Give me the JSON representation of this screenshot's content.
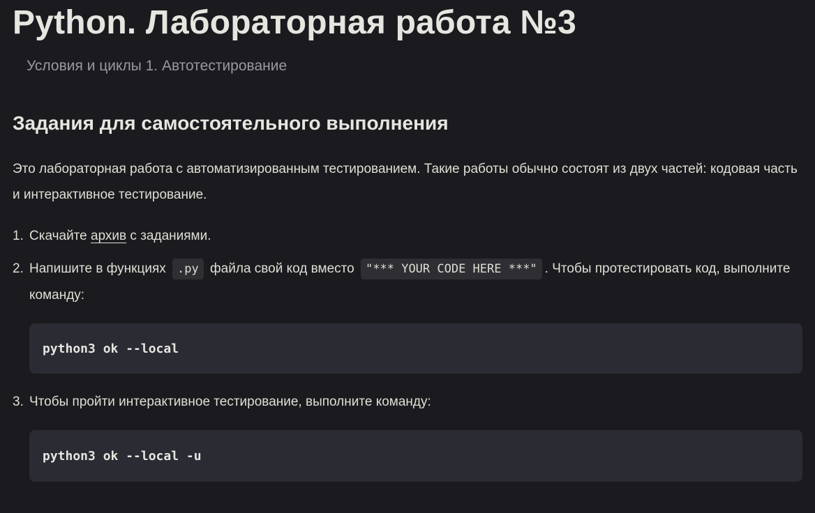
{
  "page": {
    "title": "Python. Лабораторная работа №3",
    "subtitle": "Условия и циклы 1. Автотестирование"
  },
  "section": {
    "heading": "Задания для самостоятельного выполнения",
    "intro": "Это лабораторная работа с автоматизированным тестированием. Такие работы обычно состоят из двух частей: кодовая часть и интерактивное тестирование."
  },
  "steps": [
    {
      "num": "1.",
      "before": "Скачайте ",
      "link": "архив",
      "after": " с заданиями."
    },
    {
      "num": "2.",
      "part1": "Напишите в функциях",
      "code1": ".py",
      "part2": "файла свой код вместо",
      "code2": "\"*** YOUR CODE HERE ***\"",
      "part3": ". Чтобы протестировать код, выполните команду:",
      "command": "python3 ok --local"
    },
    {
      "num": "3.",
      "text": "Чтобы пройти интерактивное тестирование, выполните команду:",
      "command": "python3 ok --local -u"
    }
  ]
}
